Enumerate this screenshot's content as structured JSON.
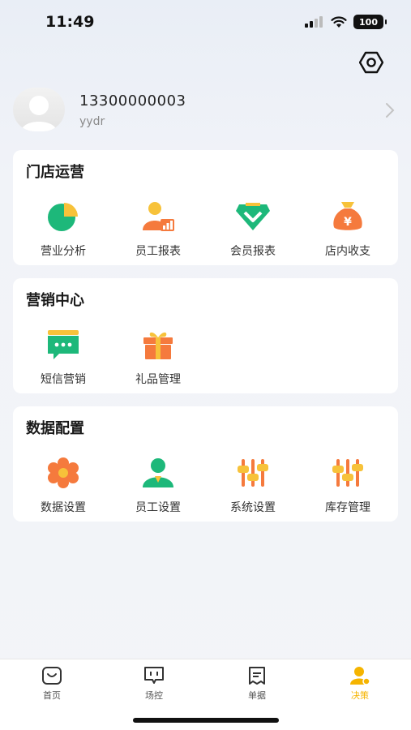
{
  "status_bar": {
    "time": "11:49",
    "battery": "100"
  },
  "header": {
    "settings_icon": "hexagon-gear-icon"
  },
  "profile": {
    "phone": "13300000003",
    "username": "yydr"
  },
  "sections": [
    {
      "title": "门店运营",
      "items": [
        {
          "label": "营业分析",
          "icon": "pie-chart-icon"
        },
        {
          "label": "员工报表",
          "icon": "staff-chart-icon"
        },
        {
          "label": "会员报表",
          "icon": "member-diamond-icon"
        },
        {
          "label": "店内收支",
          "icon": "money-bag-icon"
        }
      ]
    },
    {
      "title": "营销中心",
      "items": [
        {
          "label": "短信营销",
          "icon": "sms-icon"
        },
        {
          "label": "礼品管理",
          "icon": "gift-icon"
        }
      ]
    },
    {
      "title": "数据配置",
      "items": [
        {
          "label": "数据设置",
          "icon": "flower-gear-icon"
        },
        {
          "label": "员工设置",
          "icon": "staff-icon"
        },
        {
          "label": "系统设置",
          "icon": "sliders-icon"
        },
        {
          "label": "库存管理",
          "icon": "sliders-icon"
        }
      ]
    }
  ],
  "tabbar": [
    {
      "label": "首页",
      "icon": "home-icon"
    },
    {
      "label": "场控",
      "icon": "monitor-icon"
    },
    {
      "label": "单据",
      "icon": "document-icon"
    },
    {
      "label": "决策",
      "icon": "person-icon",
      "active": true
    }
  ],
  "colors": {
    "accent": "#f5b400",
    "green": "#1db87a",
    "orange": "#f57a3d"
  }
}
